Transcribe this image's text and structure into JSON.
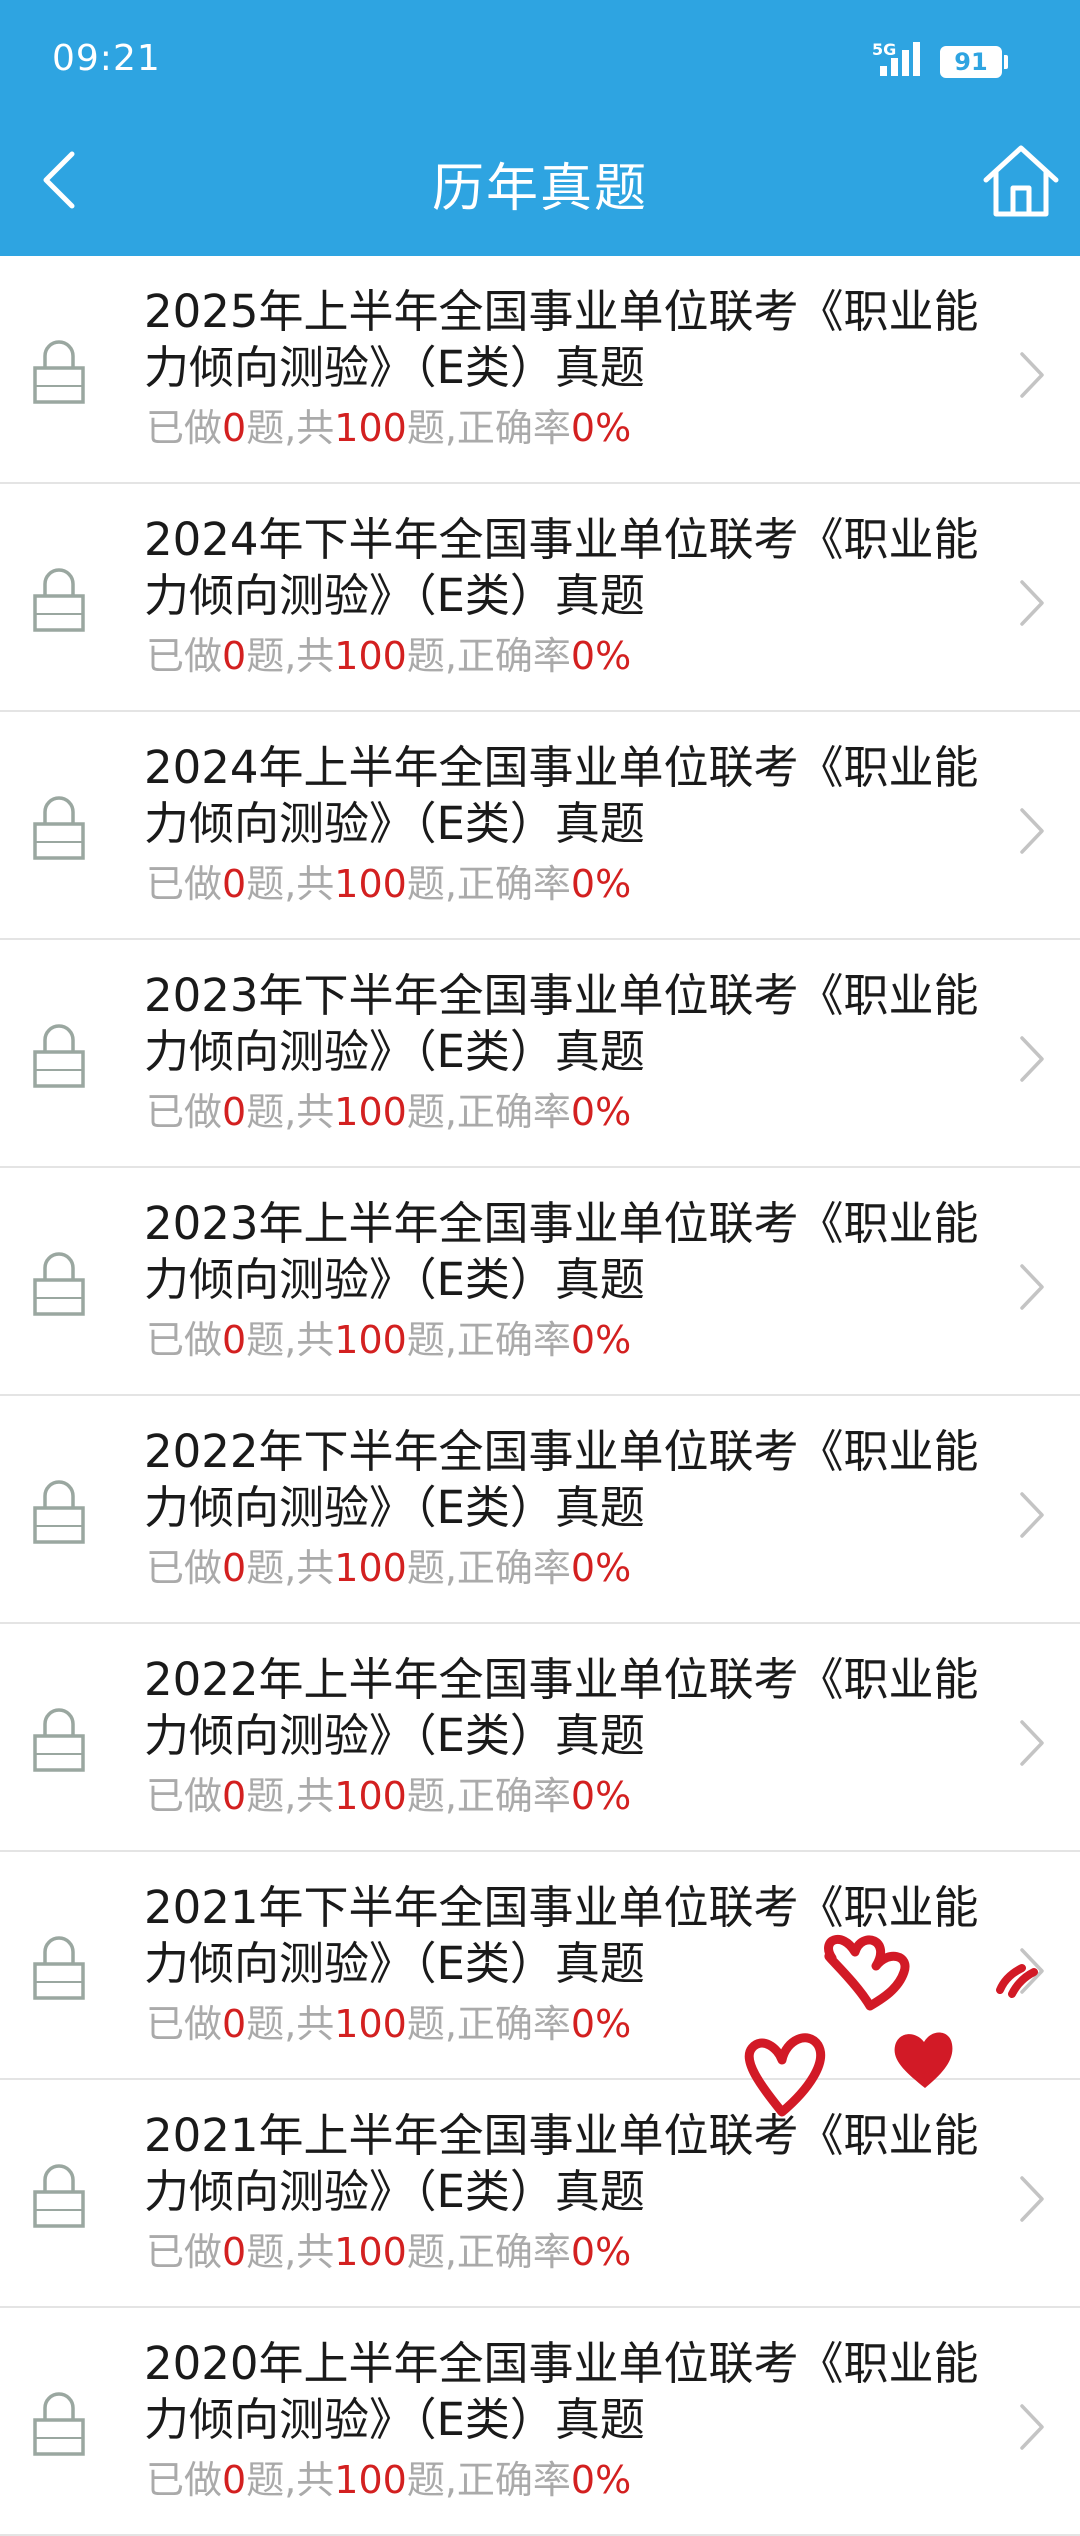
{
  "status_bar": {
    "time": "09:21",
    "network": "5G",
    "battery": "91"
  },
  "header": {
    "title": "历年真题"
  },
  "colors": {
    "header_bg": "#2ea4e1",
    "accent_red": "#d32020",
    "stat_gray": "#aaaaaa"
  },
  "icons": {
    "back": "chevron-left-icon",
    "home": "home-icon",
    "lock": "lock-icon",
    "row_arrow": "chevron-right-icon"
  },
  "items": [
    {
      "title": "2025年上半年全国事业单位联考《职业能力倾向测验》（E类）真题",
      "stat_done_label": "已做",
      "stat_done": "0",
      "stat_total_label": "题,共",
      "stat_total": "100",
      "stat_rate_label": "题,正确率",
      "stat_rate": "0%"
    },
    {
      "title": "2024年下半年全国事业单位联考《职业能力倾向测验》（E类）真题",
      "stat_done_label": "已做",
      "stat_done": "0",
      "stat_total_label": "题,共",
      "stat_total": "100",
      "stat_rate_label": "题,正确率",
      "stat_rate": "0%"
    },
    {
      "title": "2024年上半年全国事业单位联考《职业能力倾向测验》（E类）真题",
      "stat_done_label": "已做",
      "stat_done": "0",
      "stat_total_label": "题,共",
      "stat_total": "100",
      "stat_rate_label": "题,正确率",
      "stat_rate": "0%"
    },
    {
      "title": "2023年下半年全国事业单位联考《职业能力倾向测验》（E类）真题",
      "stat_done_label": "已做",
      "stat_done": "0",
      "stat_total_label": "题,共",
      "stat_total": "100",
      "stat_rate_label": "题,正确率",
      "stat_rate": "0%"
    },
    {
      "title": "2023年上半年全国事业单位联考《职业能力倾向测验》（E类）真题",
      "stat_done_label": "已做",
      "stat_done": "0",
      "stat_total_label": "题,共",
      "stat_total": "100",
      "stat_rate_label": "题,正确率",
      "stat_rate": "0%"
    },
    {
      "title": "2022年下半年全国事业单位联考《职业能力倾向测验》（E类）真题",
      "stat_done_label": "已做",
      "stat_done": "0",
      "stat_total_label": "题,共",
      "stat_total": "100",
      "stat_rate_label": "题,正确率",
      "stat_rate": "0%"
    },
    {
      "title": "2022年上半年全国事业单位联考《职业能力倾向测验》（E类）真题",
      "stat_done_label": "已做",
      "stat_done": "0",
      "stat_total_label": "题,共",
      "stat_total": "100",
      "stat_rate_label": "题,正确率",
      "stat_rate": "0%"
    },
    {
      "title": "2021年下半年全国事业单位联考《职业能力倾向测验》（E类）真题",
      "stat_done_label": "已做",
      "stat_done": "0",
      "stat_total_label": "题,共",
      "stat_total": "100",
      "stat_rate_label": "题,正确率",
      "stat_rate": "0%"
    },
    {
      "title": "2021年上半年全国事业单位联考《职业能力倾向测验》（E类）真题",
      "stat_done_label": "已做",
      "stat_done": "0",
      "stat_total_label": "题,共",
      "stat_total": "100",
      "stat_rate_label": "题,正确率",
      "stat_rate": "0%"
    },
    {
      "title": "2020年上半年全国事业单位联考《职业能力倾向测验》（E类）真题",
      "stat_done_label": "已做",
      "stat_done": "0",
      "stat_total_label": "题,共",
      "stat_total": "100",
      "stat_rate_label": "题,正确率",
      "stat_rate": "0%"
    }
  ]
}
